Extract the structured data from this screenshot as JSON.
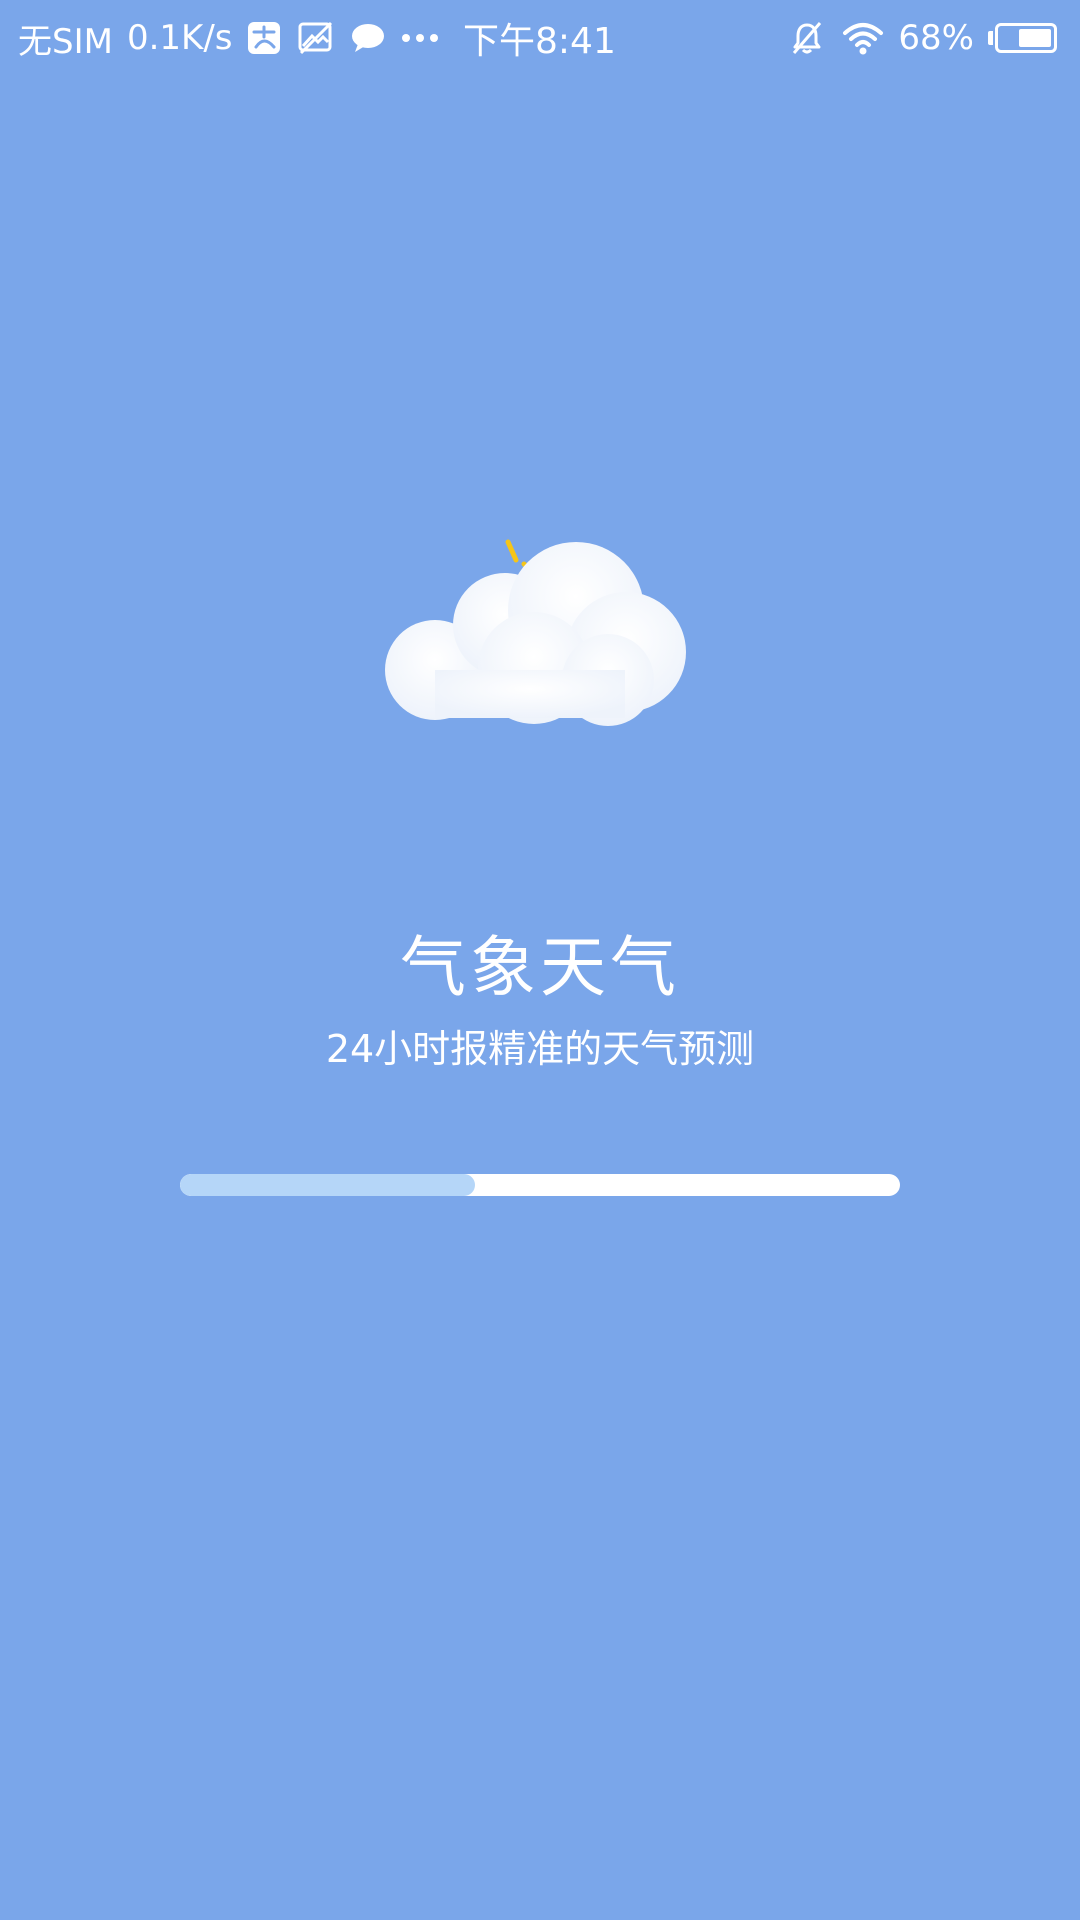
{
  "status_bar": {
    "carrier": "无SIM",
    "net_speed": "0.1K/s",
    "icons_left": [
      "alipay-icon",
      "image-off-icon",
      "chat-bubble-icon",
      "more-dots-icon"
    ],
    "time": "下午8:41",
    "icons_right": [
      "alarm-off-icon",
      "wifi-icon"
    ],
    "battery_text": "68%",
    "battery_level": 0.68
  },
  "splash": {
    "logo_icon": "cloud-sun-icon",
    "title": "气象天气",
    "subtitle": "24小时报精准的天气预测",
    "progress": 0.41
  },
  "colors": {
    "background": "#7aa6ea",
    "progress_track": "#ffffff",
    "progress_fill": "#b5d6f8",
    "sun_accent": "#f5c518",
    "text": "#ffffff"
  }
}
